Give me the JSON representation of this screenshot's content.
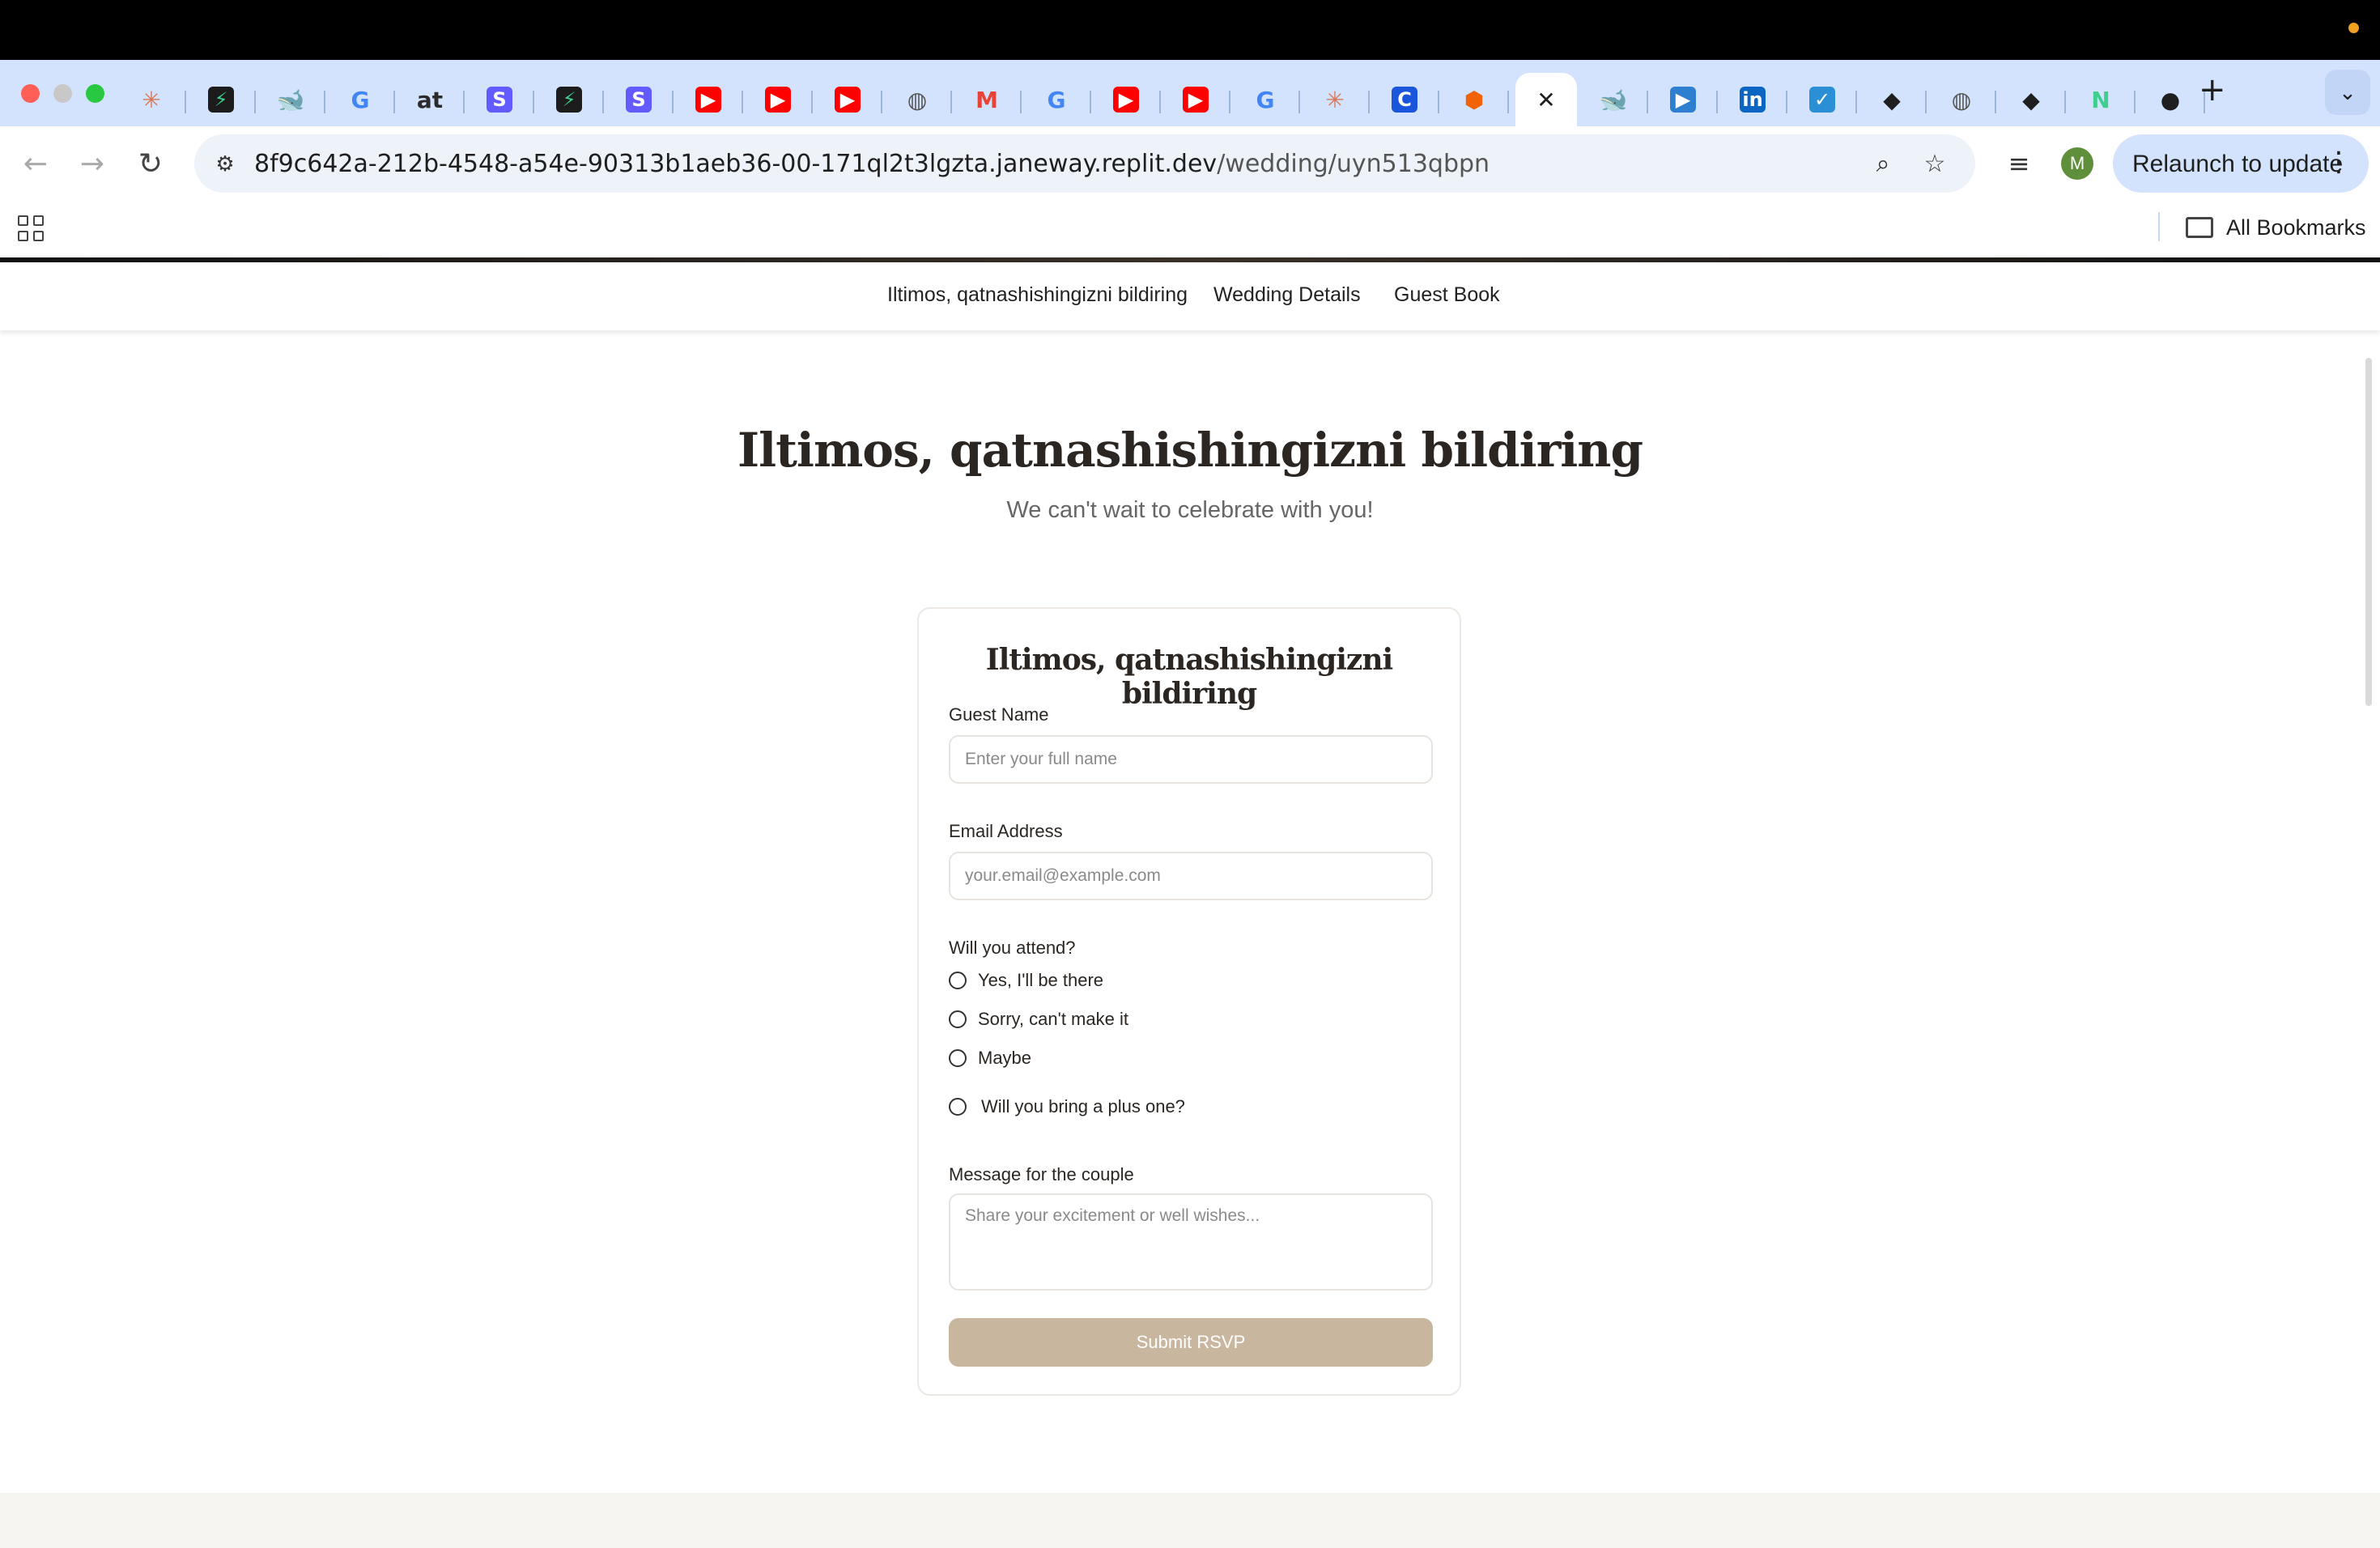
{
  "browser": {
    "tabs": [
      {
        "icon": "claude-icon",
        "glyph": "✳",
        "color": "#d97757",
        "bg": "transparent"
      },
      {
        "icon": "supabase-icon",
        "glyph": "⚡",
        "color": "#3ecf8e",
        "bg": "#1c1c1c"
      },
      {
        "icon": "deepseek-icon",
        "glyph": "🐋",
        "color": "#4d6bfe",
        "bg": "transparent"
      },
      {
        "icon": "google-icon",
        "glyph": "G",
        "color": "#4285f4",
        "bg": "transparent"
      },
      {
        "icon": "at-icon",
        "glyph": "at",
        "color": "#2b2b2b",
        "bg": "transparent"
      },
      {
        "icon": "stripe-icon",
        "glyph": "S",
        "color": "#ffffff",
        "bg": "#635bff"
      },
      {
        "icon": "supabase-icon",
        "glyph": "⚡",
        "color": "#3ecf8e",
        "bg": "#1c1c1c"
      },
      {
        "icon": "stripe-icon",
        "glyph": "S",
        "color": "#ffffff",
        "bg": "#635bff"
      },
      {
        "icon": "youtube-icon",
        "glyph": "▶",
        "color": "#ffffff",
        "bg": "#ff0000"
      },
      {
        "icon": "youtube-icon",
        "glyph": "▶",
        "color": "#ffffff",
        "bg": "#ff0000"
      },
      {
        "icon": "youtube-icon",
        "glyph": "▶",
        "color": "#ffffff",
        "bg": "#ff0000"
      },
      {
        "icon": "globe-icon",
        "glyph": "◍",
        "color": "#555555",
        "bg": "transparent"
      },
      {
        "icon": "gmail-icon",
        "glyph": "M",
        "color": "#ea4335",
        "bg": "transparent"
      },
      {
        "icon": "google-icon",
        "glyph": "G",
        "color": "#4285f4",
        "bg": "transparent"
      },
      {
        "icon": "youtube-icon",
        "glyph": "▶",
        "color": "#ffffff",
        "bg": "#ff0000"
      },
      {
        "icon": "youtube-icon",
        "glyph": "▶",
        "color": "#ffffff",
        "bg": "#ff0000"
      },
      {
        "icon": "google-icon",
        "glyph": "G",
        "color": "#4285f4",
        "bg": "transparent"
      },
      {
        "icon": "claude-icon",
        "glyph": "✳",
        "color": "#d97757",
        "bg": "transparent"
      },
      {
        "icon": "c-icon",
        "glyph": "C",
        "color": "#ffffff",
        "bg": "#1a56db"
      },
      {
        "icon": "replit-icon",
        "glyph": "⬢",
        "color": "#f26207",
        "bg": "transparent"
      },
      {
        "icon": "close-icon",
        "glyph": "✕",
        "color": "#1f1f1f",
        "bg": "transparent",
        "active": true
      },
      {
        "icon": "deepseek-icon",
        "glyph": "🐋",
        "color": "#4d6bfe",
        "bg": "transparent"
      },
      {
        "icon": "video-icon",
        "glyph": "▶",
        "color": "#ffffff",
        "bg": "#2f7fd1"
      },
      {
        "icon": "linkedin-icon",
        "glyph": "in",
        "color": "#ffffff",
        "bg": "#0a66c2"
      },
      {
        "icon": "tasks-icon",
        "glyph": "✓",
        "color": "#ffffff",
        "bg": "#2b8fd6"
      },
      {
        "icon": "app-icon",
        "glyph": "◆",
        "color": "#1f1f1f",
        "bg": "transparent"
      },
      {
        "icon": "globe-icon",
        "glyph": "◍",
        "color": "#555555",
        "bg": "transparent"
      },
      {
        "icon": "app-icon",
        "glyph": "◆",
        "color": "#1f1f1f",
        "bg": "transparent"
      },
      {
        "icon": "notion-icon",
        "glyph": "N",
        "color": "#3ecf8e",
        "bg": "transparent"
      },
      {
        "icon": "github-icon",
        "glyph": "●",
        "color": "#1f1f1f",
        "bg": "transparent"
      }
    ],
    "url_host": "8f9c642a-212b-4548-a54e-90313b1aeb36-00-171ql2t3lgzta.janeway.replit.dev",
    "url_path": "/wedding/uyn513qbpn",
    "avatar_letter": "M",
    "relaunch_label": "Relaunch to update",
    "all_bookmarks_label": "All Bookmarks"
  },
  "site_nav": {
    "items": [
      "Iltimos, qatnashishingizni bildiring",
      "Wedding Details",
      "Guest Book"
    ]
  },
  "rsvp": {
    "heading": "Iltimos, qatnashishingizni bildiring",
    "subheading": "We can't wait to celebrate with you!",
    "card_title": "Iltimos, qatnashishingizni bildiring",
    "guest_name_label": "Guest Name",
    "guest_name_placeholder": "Enter your full name",
    "email_label": "Email Address",
    "email_placeholder": "your.email@example.com",
    "attend_label": "Will you attend?",
    "attend_options": [
      "Yes, I'll be there",
      "Sorry, can't make it",
      "Maybe"
    ],
    "plus_one_label": "Will you bring a plus one?",
    "message_label": "Message for the couple",
    "message_placeholder": "Share your excitement or well wishes...",
    "submit_label": "Submit RSVP"
  },
  "colors": {
    "accent_button": "#c8b69e",
    "heading_text": "#2b2622",
    "tabstrip": "#d3e3fd",
    "footer_band": "#f7f5f1"
  }
}
